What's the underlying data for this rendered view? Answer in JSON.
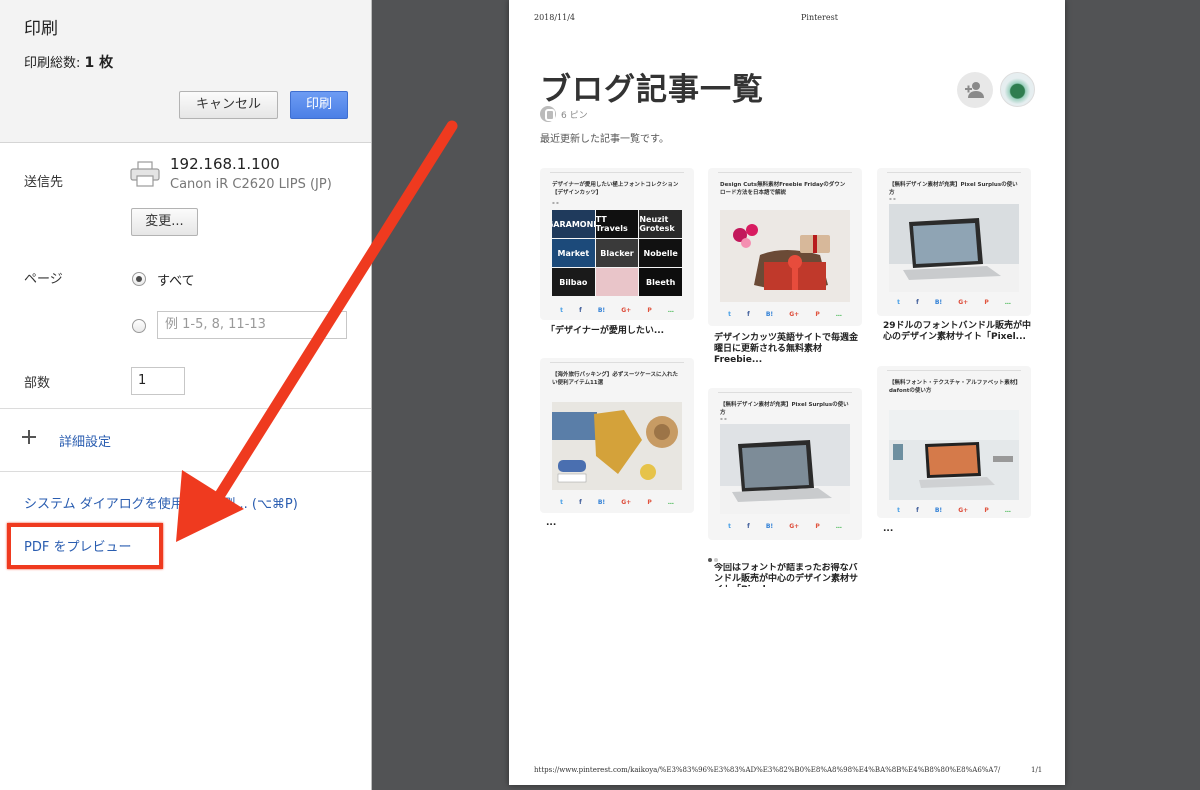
{
  "dialog": {
    "title": "印刷",
    "total_label": "印刷総数: ",
    "total_value": "1 枚",
    "cancel_label": "キャンセル",
    "print_label": "印刷"
  },
  "destination": {
    "label": "送信先",
    "printer_ip": "192.168.1.100",
    "printer_model": "Canon iR C2620 LIPS (JP)",
    "change_label": "変更..."
  },
  "pages": {
    "label": "ページ",
    "all_label": "すべて",
    "range_placeholder": "例 1-5, 8, 11-13"
  },
  "copies": {
    "label": "部数",
    "value": "1"
  },
  "advanced_label": "詳細設定",
  "system_dialog_label": "システム ダイアログを使用して印刷... (⌥⌘P)",
  "pdf_preview_label": "PDF をプレビュー",
  "annotation": {
    "color": "#ef3a1f"
  },
  "preview": {
    "date": "2018/11/4",
    "header_title": "Pinterest",
    "board_title": "ブログ記事一覧",
    "pin_count": "6 ピン",
    "description": "最近更新した記事一覧です。",
    "footer_url": "https://www.pinterest.com/kaikoya/%E3%83%96%E3%83%AD%E3%82%B0%E8%A8%98%E4%BA%8B%E4%B8%80%E8%A6%A7/",
    "page_number": "1/1",
    "cards": [
      {
        "title": "デザイナーが愛用したい極上フォントコレクション【デザインカッツ】",
        "caption": "「デザイナーが愛用したい...",
        "fonts": [
          "GARAMOND",
          "TT Travels",
          "Neuzit Grotesk",
          "Market",
          "Blacker",
          "Nobelle",
          "Bilbao",
          "",
          "Bleeth"
        ]
      },
      {
        "title": "Design Cuts無料素材Freebie Fridayのダウンロード方法を日本語で解説",
        "caption": "デザインカッツ英語サイトで毎週金曜日に更新される無料素材Freebie..."
      },
      {
        "title": "【無料デザイン素材が充実】Pixel Surplusの使い方",
        "caption": "29ドルのフォントバンドル販売が中心のデザイン素材サイト「Pixel..."
      },
      {
        "title": "【海外旅行パッキング】必ずスーツケースに入れたい便利アイテム11選",
        "caption": "..."
      },
      {
        "title": "【無料デザイン素材が充実】Pixel Surplusの使い方",
        "caption": "今回はフォントが詰まったお得なバンドル販売が中心のデザイン素材サイト「Pixel..."
      },
      {
        "title": "【無料フォント・テクスチャ・アルファベット素材】dafontの使い方",
        "caption": "..."
      }
    ],
    "share_icons": [
      "t",
      "f",
      "B!",
      "G+",
      "P",
      "…"
    ]
  }
}
